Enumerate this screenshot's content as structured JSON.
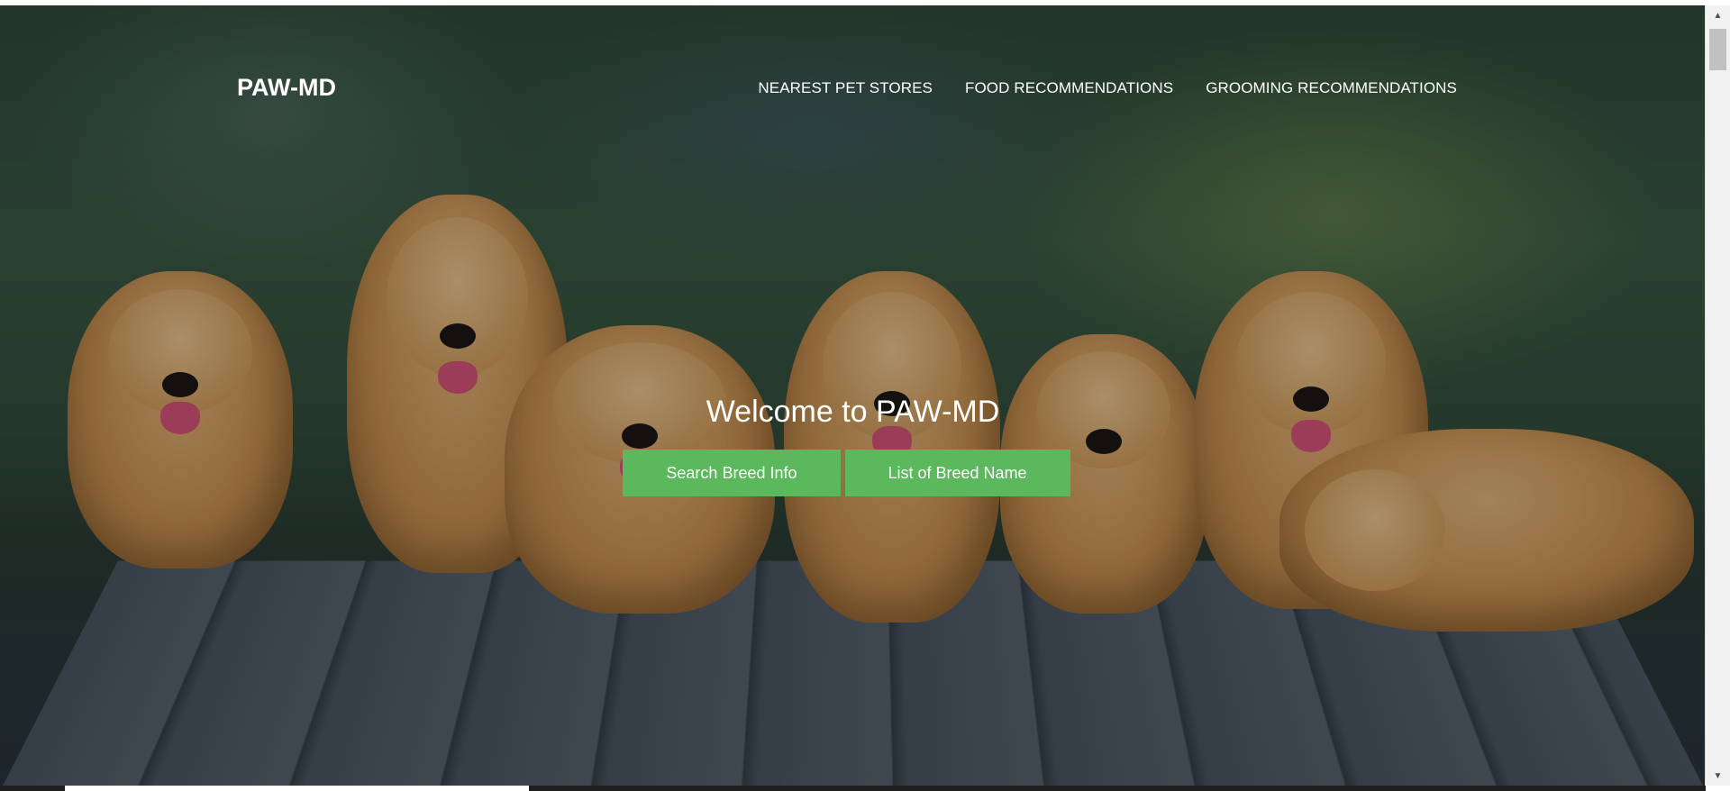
{
  "navbar": {
    "brand": "PAW-MD",
    "links": [
      {
        "label": "NEAREST PET STORES"
      },
      {
        "label": "FOOD RECOMMENDATIONS"
      },
      {
        "label": "GROOMING RECOMMENDATIONS"
      }
    ]
  },
  "hero": {
    "title": "Welcome to PAW-MD",
    "buttons": [
      {
        "label": "Search Breed Info"
      },
      {
        "label": "List of Breed Name"
      }
    ],
    "background_image": "golden-retriever-puppies-photo"
  },
  "colors": {
    "button_bg": "#5cb85c",
    "text": "#ffffff"
  },
  "scrollbar": {
    "up_icon": "scroll-up-arrow-icon",
    "down_icon": "scroll-down-arrow-icon"
  }
}
